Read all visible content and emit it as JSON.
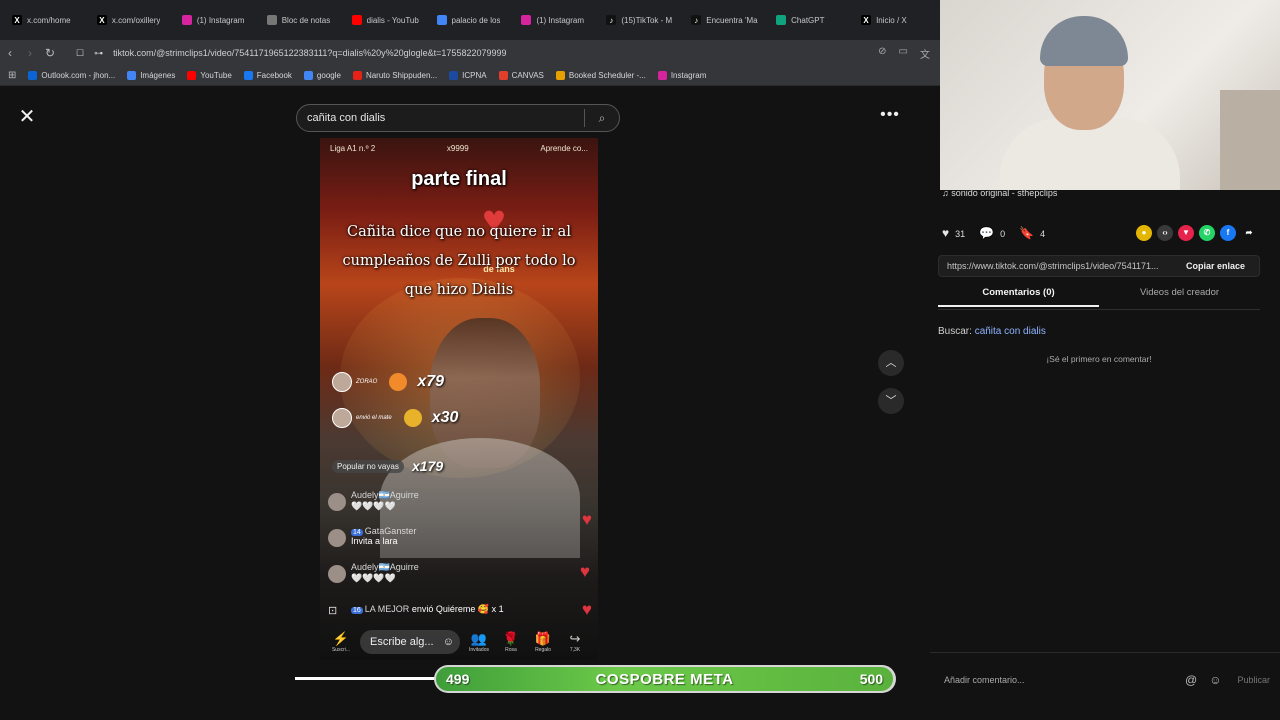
{
  "browser": {
    "tabs": [
      {
        "title": "x.com/home",
        "icon": "x-icon",
        "color": "#000000",
        "glyph": "X"
      },
      {
        "title": "x.com/oxillery",
        "icon": "x-icon",
        "color": "#000000",
        "glyph": "X"
      },
      {
        "title": "(1) Instagram",
        "icon": "instagram-icon",
        "color": "#d6249f",
        "glyph": ""
      },
      {
        "title": "Bloc de notas",
        "icon": "notepad-icon",
        "color": "#777777",
        "glyph": ""
      },
      {
        "title": "dialis - YouTub",
        "icon": "youtube-icon",
        "color": "#ff0000",
        "glyph": ""
      },
      {
        "title": "palacio de los",
        "icon": "google-icon",
        "color": "#4285f4",
        "glyph": ""
      },
      {
        "title": "(1) Instagram",
        "icon": "instagram-icon",
        "color": "#d6249f",
        "glyph": ""
      },
      {
        "title": "(15)TikTok - M",
        "icon": "tiktok-icon",
        "color": "#111111",
        "glyph": "♪"
      },
      {
        "title": "Encuentra 'Ma",
        "icon": "tiktok-icon",
        "color": "#111111",
        "glyph": "♪"
      },
      {
        "title": "ChatGPT",
        "icon": "chatgpt-icon",
        "color": "#10a37f",
        "glyph": ""
      },
      {
        "title": "Inicio / X",
        "icon": "x-icon",
        "color": "#000000",
        "glyph": "X"
      }
    ],
    "url": "tiktok.com/@strimclips1/video/7541171965122383111?q=dialis%20y%20glogle&t=1755822079999",
    "bookmarks": [
      {
        "label": "Outlook.com - jhon...",
        "color": "#0a64d6"
      },
      {
        "label": "Imágenes",
        "color": "#4285f4"
      },
      {
        "label": "YouTube",
        "color": "#ff0000"
      },
      {
        "label": "Facebook",
        "color": "#1877f2"
      },
      {
        "label": "google",
        "color": "#4285f4"
      },
      {
        "label": "Naruto Shippuden...",
        "color": "#e62117"
      },
      {
        "label": "ICPNA",
        "color": "#1b4aa0"
      },
      {
        "label": "CANVAS",
        "color": "#e13f2b"
      },
      {
        "label": "Booked Scheduler -...",
        "color": "#e6a100"
      },
      {
        "label": "Instagram",
        "color": "#d6249f"
      }
    ]
  },
  "search": {
    "query": "cañita con dialis"
  },
  "video": {
    "top_left": "Liga A1 n.º 2",
    "top_mid": "x9999",
    "top_right": "Aprende co...",
    "heading": "parte final",
    "caption": "Cañita dice que no quiere ir al cumpleaños de Zulli por todo lo que hizo Dialis",
    "fan_label": "de fans",
    "gifts": [
      {
        "name": "ZORAO",
        "mult": "x79"
      },
      {
        "name": "envió el mate",
        "mult": "x30"
      }
    ],
    "chip": "Popular no vayas",
    "chip_mult": "x179",
    "comments": [
      {
        "user": "Audely🇦🇷Aguirre",
        "badge": "",
        "text": "🤍🤍🤍🤍"
      },
      {
        "user": "GataGanster",
        "badge": "14",
        "text": "Invita a lara"
      },
      {
        "user": "Audely🇦🇷Aguirre",
        "badge": "",
        "text": "🤍🤍🤍🤍"
      },
      {
        "user": "LA MEJOR",
        "badge": "16",
        "text": "envió Quiéreme 🥰 x 1"
      }
    ],
    "input_placeholder": "Escribe alg...",
    "actions": [
      {
        "label": "Invitados",
        "glyph": "👥"
      },
      {
        "label": "Rosa",
        "glyph": "🌹"
      },
      {
        "label": "Regalo",
        "glyph": "🎁"
      },
      {
        "label": "7,3K",
        "glyph": "↪"
      }
    ],
    "first_action": "Suscri..."
  },
  "goal": {
    "current": "499",
    "label": "COSPOBRE META",
    "target": "500",
    "progress": 0.998
  },
  "panel": {
    "sound": "sonido original - sthepclips",
    "likes": "31",
    "comments": "0",
    "saves": "4",
    "link": "https://www.tiktok.com/@strimclips1/video/7541171...",
    "copy_label": "Copiar enlace",
    "tab_comments": "Comentarios (0)",
    "tab_creator": "Videos del creador",
    "search_prefix": "Buscar:",
    "search_keyword": "cañita con dialis",
    "empty_text": "¡Sé el primero en comentar!",
    "comment_placeholder": "Añadir comentario...",
    "publish_label": "Publicar"
  },
  "colors": {
    "accent_green": "#5ab23d",
    "like_red": "#e0353f"
  }
}
